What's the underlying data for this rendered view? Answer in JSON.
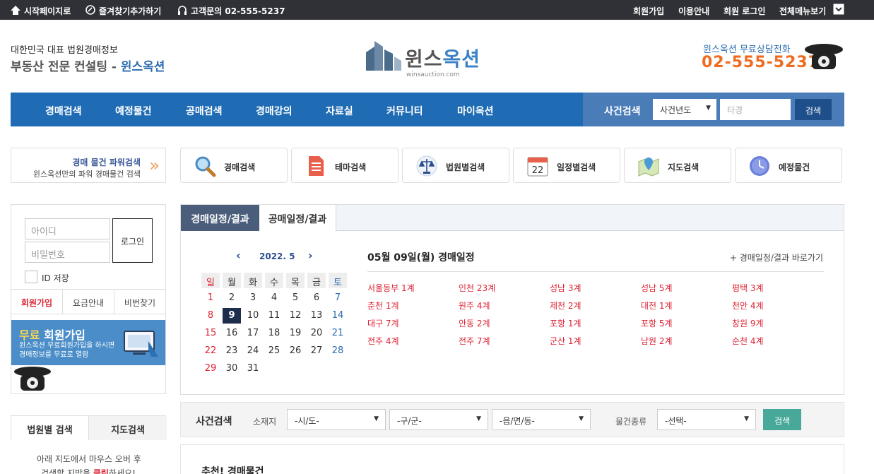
{
  "topbar": {
    "home": "시작페이지로",
    "favorite": "즐겨찾기추가하기",
    "support": "고객문의 02-555-5237",
    "right": [
      "회원가입",
      "이용안내",
      "회원 로그인",
      "전체메뉴보기"
    ]
  },
  "header": {
    "tagline1": "대한민국 대표 법원경매정보",
    "tagline2_prefix": "부동산 전문 컨설팅 - ",
    "tagline2_brand": "윈스옥션",
    "logo_a": "윈스",
    "logo_b": "옥션",
    "logo_sub": "winsauction.com",
    "phone_label": "윈스옥션 무료상담전화",
    "phone_number": "02-555-5237"
  },
  "nav": {
    "items": [
      "경매검색",
      "예정물건",
      "공매검색",
      "경매강의",
      "자료실",
      "커뮤니티",
      "마이옥션"
    ],
    "search_label": "사건검색",
    "year_select": "사건년도",
    "case_placeholder": "타경",
    "search_button": "검색"
  },
  "power": {
    "title": "경매 물건 파워검색",
    "desc": "윈스옥션만의 파워 경매물건 검색"
  },
  "quick": [
    {
      "label": "경매검색",
      "icon": "magnifier-icon"
    },
    {
      "label": "테마검색",
      "icon": "document-icon"
    },
    {
      "label": "법원별검색",
      "icon": "court-icon"
    },
    {
      "label": "일정별검색",
      "icon": "calendar-icon",
      "num": "22"
    },
    {
      "label": "지도검색",
      "icon": "map-icon"
    },
    {
      "label": "예정물건",
      "icon": "clock-icon"
    }
  ],
  "login": {
    "id_placeholder": "아이디",
    "pw_placeholder": "비밀번호",
    "button": "로그인",
    "save_id": "ID 저장",
    "links": [
      "회원가입",
      "요금안내",
      "비번찾기"
    ],
    "banner_free": "무료",
    "banner_title": " 회원가입",
    "banner_desc1": "윈스옥션 무료회원가입을 하시면",
    "banner_desc2": "경매정보를 무료로 열람"
  },
  "left_tabs": {
    "court": "법원별 검색",
    "map": "지도검색",
    "help1": "아래 지도에서 마우스 오버 후",
    "help2_prefix": "검색할 지방을 ",
    "help2_em": "클릭",
    "help2_suffix": "하세요!"
  },
  "schedule": {
    "tab_active": "경매일정/결과",
    "tab_other": "공매일정/결과",
    "month": "2022. 5",
    "weekdays": [
      "일",
      "월",
      "화",
      "수",
      "목",
      "금",
      "토"
    ],
    "weeks": [
      [
        "1",
        "2",
        "3",
        "4",
        "5",
        "6",
        "7"
      ],
      [
        "8",
        "9",
        "10",
        "11",
        "12",
        "13",
        "14"
      ],
      [
        "15",
        "16",
        "17",
        "18",
        "19",
        "20",
        "21"
      ],
      [
        "22",
        "23",
        "24",
        "25",
        "26",
        "27",
        "28"
      ],
      [
        "29",
        "30",
        "31",
        "",
        "",
        "",
        ""
      ]
    ],
    "today": "9",
    "day_title": "05월 09일(월) 경매일정",
    "day_link": "+ 경매일정/결과 바로가기",
    "courts": [
      [
        "서울동부 1계",
        "인천 23계",
        "성남 3계",
        "성남 5계",
        "평택 3계"
      ],
      [
        "춘천 1계",
        "원주 4계",
        "제천 2계",
        "대전 1계",
        "천안 4계"
      ],
      [
        "대구 7계",
        "안동 2계",
        "포항 1계",
        "포항 5계",
        "창원 9계"
      ],
      [
        "전주 4계",
        "전주 7계",
        "군산 1계",
        "남원 2계",
        "순천 4계"
      ]
    ]
  },
  "case_search": {
    "label": "사건검색",
    "location": "소재지",
    "sido": "-시/도-",
    "gugun": "-구/군-",
    "dong": "-읍/면/동-",
    "kind_label": "물건종류",
    "kind": "-선택-",
    "button": "검색"
  },
  "recommend": {
    "title": "추천! 경매물건"
  }
}
